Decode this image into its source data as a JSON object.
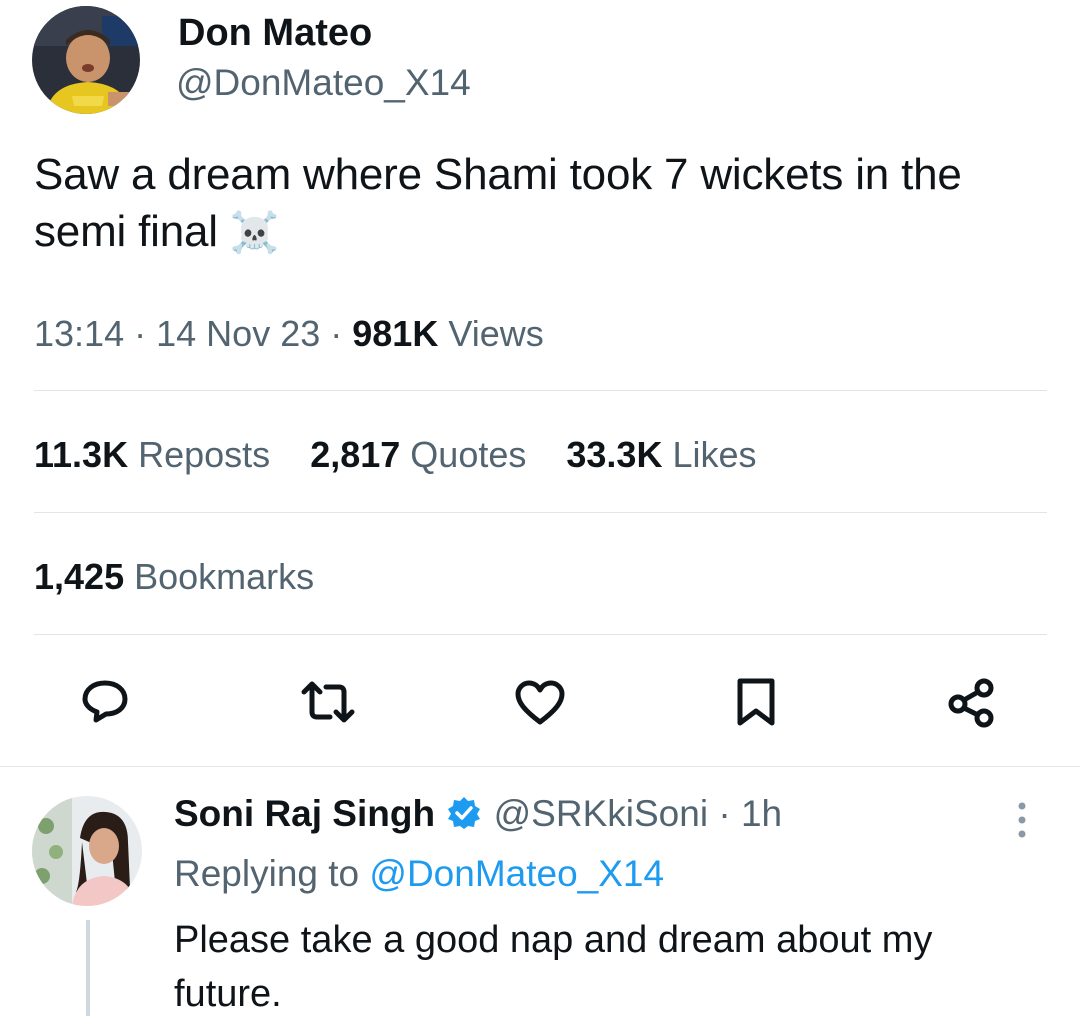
{
  "tweet": {
    "author_name": "Don Mateo",
    "author_handle": "@DonMateo_X14",
    "text": "Saw a dream where Shami took 7 wickets in the semi final",
    "emoji": "☠️",
    "time": "13:14",
    "date": "14 Nov 23",
    "views_count": "981K",
    "views_label": "Views",
    "separator": "·",
    "stats": [
      {
        "count": "11.3K",
        "label": "Reposts"
      },
      {
        "count": "2,817",
        "label": "Quotes"
      },
      {
        "count": "33.3K",
        "label": "Likes"
      }
    ],
    "bookmarks": {
      "count": "1,425",
      "label": "Bookmarks"
    },
    "actions": [
      "reply-icon",
      "repost-icon",
      "like-icon",
      "bookmark-icon",
      "share-icon"
    ]
  },
  "reply": {
    "author_name": "Soni Raj Singh",
    "verified_icon": "verified-badge-icon",
    "author_handle": "@SRKkiSoni",
    "separator": "·",
    "time_ago": "1h",
    "replying_to_label": "Replying to",
    "replying_to_handle": "@DonMateo_X14",
    "text": "Please take a good nap and dream about my future.",
    "more_icon": "more-vertical-icon"
  },
  "colors": {
    "text": "#0f1419",
    "muted": "#536471",
    "link": "#1d9bf0",
    "divider": "#e1e5e8",
    "action_icon": "#0f1419"
  }
}
